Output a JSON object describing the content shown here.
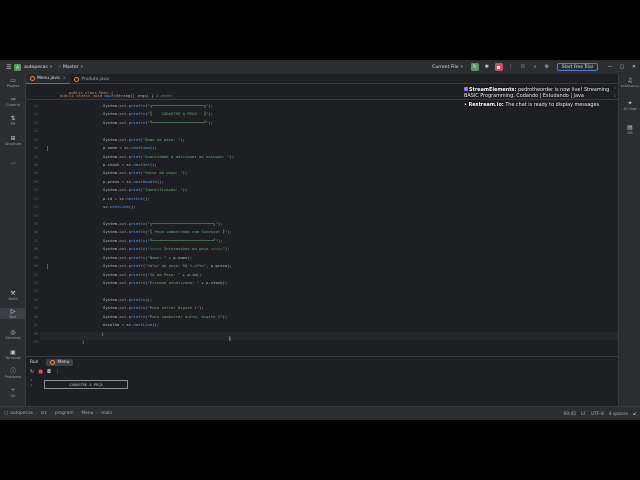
{
  "titlebar": {
    "project_badge": "A",
    "project_name": "autopecas",
    "branch": "Master",
    "run_config": "Current File",
    "trial_label": "Start Free Trial"
  },
  "left_tools": [
    {
      "label": "Project"
    },
    {
      "label": "Commit"
    },
    {
      "label": "PR"
    },
    {
      "label": "Structure"
    },
    {
      "label": "Build"
    },
    {
      "label": "Run"
    },
    {
      "label": "Services"
    },
    {
      "label": "Terminal"
    },
    {
      "label": "Problems"
    },
    {
      "label": "Git"
    }
  ],
  "right_tools": [
    {
      "label": "Notifications"
    },
    {
      "label": "AI Chat"
    },
    {
      "label": "DB"
    }
  ],
  "tabs": [
    {
      "label": "Menu.java"
    },
    {
      "label": "Produto.java"
    }
  ],
  "sticky": {
    "ln1": "4",
    "line1": "public class Menu {",
    "ln2": "5",
    "line2_kw": "public static void ",
    "line2_fn": "main",
    "line2_rest": "(String[] args) {",
    "line2_hint": "& pedro"
  },
  "code": [
    {
      "n": "41",
      "t": "System.out.println(\"╔══════════════════════╗\");"
    },
    {
      "n": "42",
      "t": "System.out.println(\"║    CADASTRE A PEÇA   ║\");"
    },
    {
      "n": "43",
      "t": "System.out.println(\"╚══════════════════════╝\");"
    },
    {
      "n": "44",
      "t": ""
    },
    {
      "n": "45",
      "t": "System.out.print(\"Nome da peça: \");"
    },
    {
      "n": "46",
      "t": "p.nome = sc.nextLine();"
    },
    {
      "n": "47",
      "t": "System.out.print(\"Quantidade a adicionar ao estoque: \");"
    },
    {
      "n": "48",
      "t": "p.stock = sc.nextInt();"
    },
    {
      "n": "49",
      "t": "System.out.print(\"Valor da peça: \");"
    },
    {
      "n": "50",
      "t": "p.preco = sc.nextDouble();"
    },
    {
      "n": "51",
      "t": "System.out.print(\"Identificação: \");"
    },
    {
      "n": "52",
      "t": "p.id = sc.nextInt();"
    },
    {
      "n": "53",
      "t": "sc.nextLine();"
    },
    {
      "n": "54",
      "t": ""
    },
    {
      "n": "55",
      "t": "System.out.println(\"╔══════════════════════════╗\");"
    },
    {
      "n": "56",
      "t": "System.out.println(\"║ Peça cadastrada com Sucesso! ║\");"
    },
    {
      "n": "57",
      "t": "System.out.println(\"╚══════════════════════════╝\");"
    },
    {
      "n": "58",
      "t": "System.out.println(\"===== Informações da peça =====\");"
    },
    {
      "n": "59",
      "t": "System.out.println(\"Nome: \" + p.nome);"
    },
    {
      "n": "60",
      "t": "System.out.printf(\"Valor da peça: R$ %.2f%n\", p.preco);"
    },
    {
      "n": "61",
      "t": "System.out.println(\"ID da Peça: \" + p.id);"
    },
    {
      "n": "62",
      "t": "System.out.println(\"Estoque atualizado: \" + p.stock);"
    },
    {
      "n": "63",
      "t": ""
    },
    {
      "n": "64",
      "t": "System.out.println();"
    },
    {
      "n": "65",
      "t": "System.out.println(\"Para voltar digite 1\");"
    },
    {
      "n": "66",
      "t": "System.out.println(\"Para cadastrar outro, digite 2\");"
    },
    {
      "n": "67",
      "t": "escolha = sc.nextLine();"
    },
    {
      "n": "68",
      "t": "    }"
    },
    {
      "n": "69",
      "t": "}"
    }
  ],
  "overlay": {
    "msg1_source": "StreamElements:",
    "msg1_text": " pedrotheorder is now live! Streaming BASIC Programming: Codando | Estudando | Java",
    "msg2_source": "Restream.io:",
    "msg2_text": " The chat is ready to display messages."
  },
  "run": {
    "label": "Run",
    "tab": "Menu",
    "console_box": "CADASTRE A PEÇA"
  },
  "status": {
    "crumbs": [
      "autopecas",
      "src",
      "program",
      "Menu",
      "main"
    ],
    "position": "69:45",
    "line_sep": "LF",
    "encoding": "UTF-8",
    "indent": "4 spaces"
  }
}
